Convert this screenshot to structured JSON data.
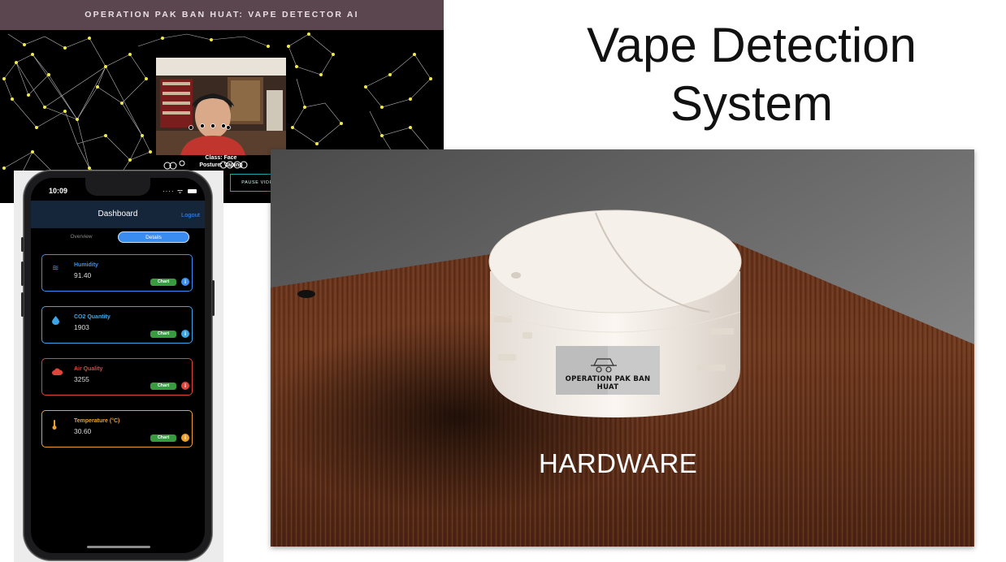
{
  "slide": {
    "title_line1": "Vape Detection",
    "title_line2": "System",
    "hardware_label": "HARDWARE"
  },
  "webapp": {
    "header": "OPERATION PAK BAN HUAT: VAPE DETECTOR AI",
    "camera_class": "Class: Face",
    "camera_posture": "Posture: Vaping",
    "pause_button": "PAUSE VIDEO"
  },
  "phone": {
    "status_time": "10:09",
    "title": "Dashboard",
    "logout": "Logout",
    "tabs": [
      {
        "label": "Overview",
        "active": false
      },
      {
        "label": "Details",
        "active": true
      }
    ],
    "cards": [
      {
        "label": "Humidity",
        "value": "91.40",
        "chart": "Chart",
        "icon": "waves-icon",
        "color": "#3b8ef5"
      },
      {
        "label": "CO2 Quantity",
        "value": "1903",
        "chart": "Chart",
        "icon": "droplet-icon",
        "color": "#3aa6e8"
      },
      {
        "label": "Air Quality",
        "value": "3255",
        "chart": "Chart",
        "icon": "cloud-icon",
        "color": "#e0443b"
      },
      {
        "label": "Temperature (°C)",
        "value": "30.60",
        "chart": "Chart",
        "icon": "thermometer-icon",
        "color": "#f0a02a"
      }
    ]
  },
  "device": {
    "logo_text": "OPERATION PAK BAN HUAT"
  }
}
